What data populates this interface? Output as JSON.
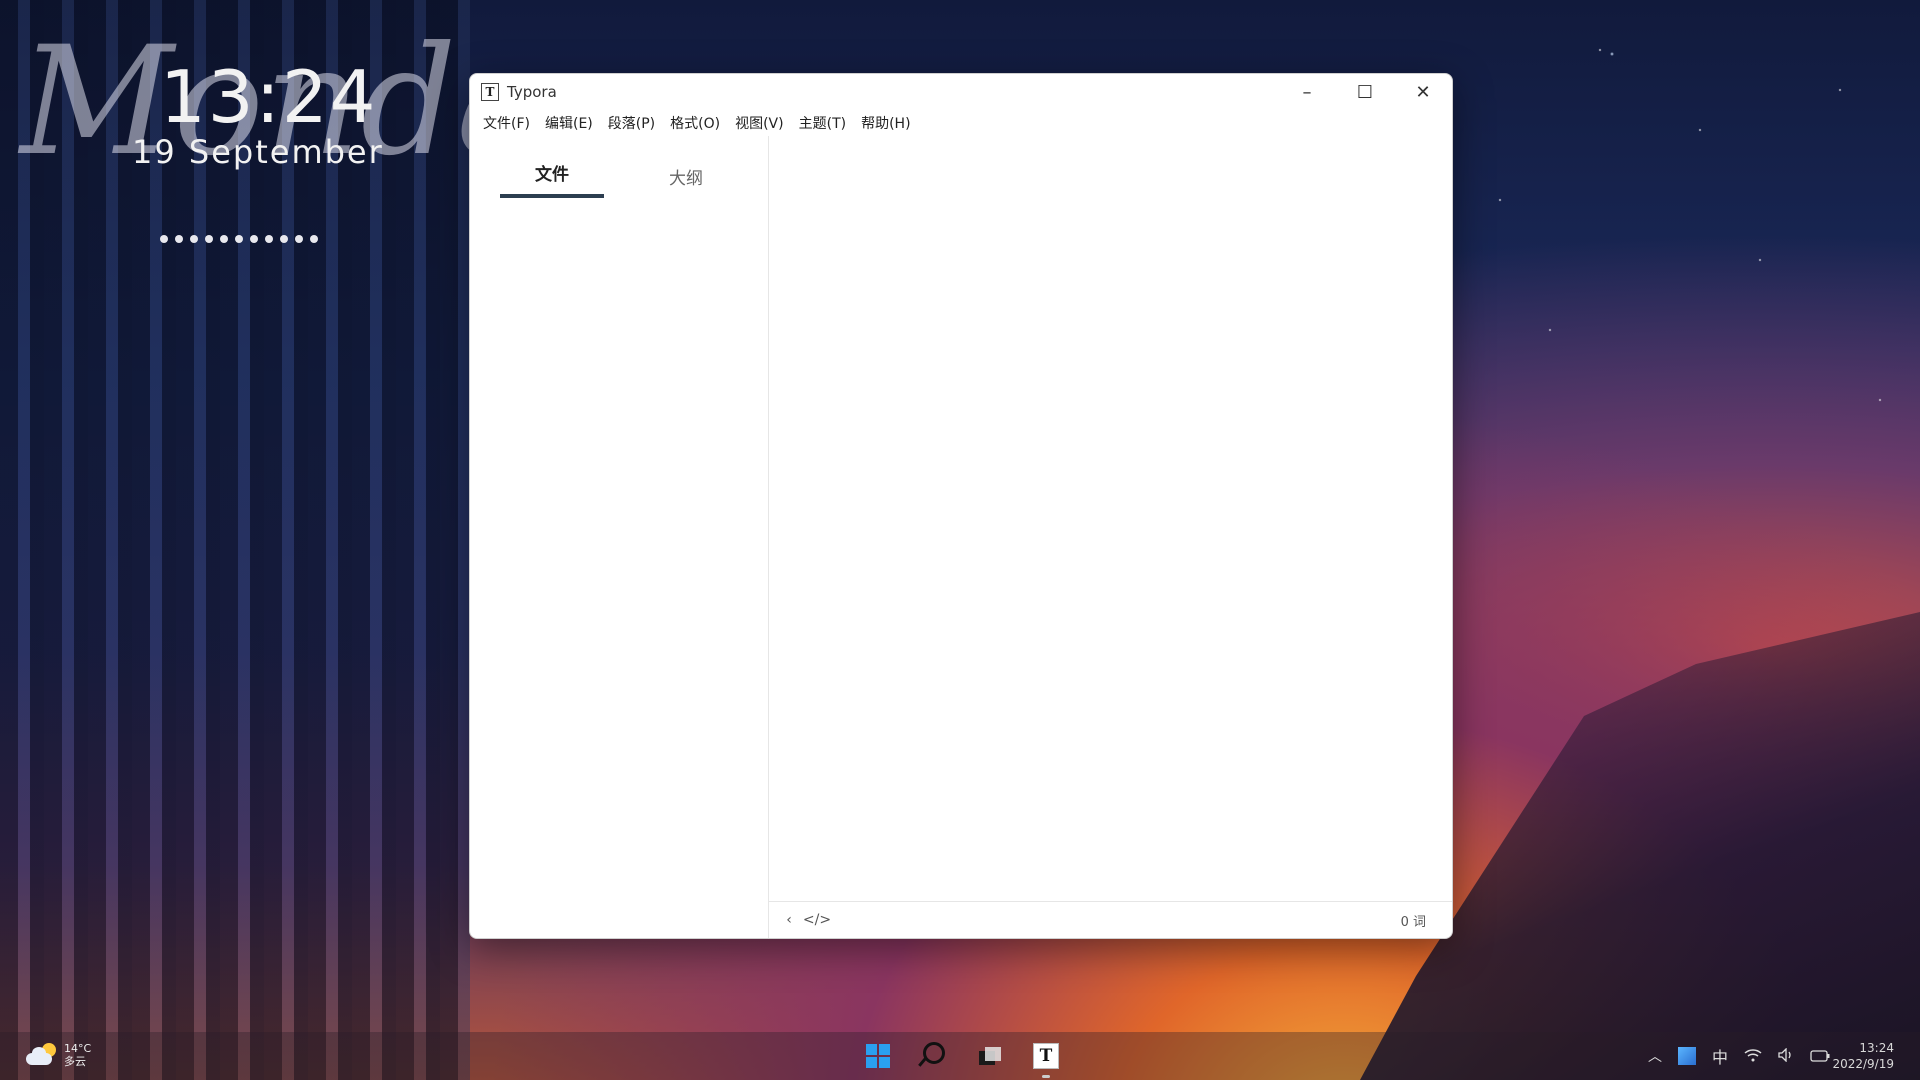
{
  "desktop": {
    "watermark": "Monday",
    "time": "13:24",
    "date": "19 September",
    "dot_count": 11
  },
  "window": {
    "title": "Typora",
    "app_icon": "T",
    "caption": {
      "minimize": "–",
      "maximize": "☐",
      "close": "✕"
    },
    "menu": [
      "文件(F)",
      "编辑(E)",
      "段落(P)",
      "格式(O)",
      "视图(V)",
      "主题(T)",
      "帮助(H)"
    ],
    "sidebar_tabs": [
      {
        "label": "文件",
        "active": true
      },
      {
        "label": "大纲",
        "active": false
      }
    ],
    "status": {
      "back_icon": "‹",
      "source_icon": "</>",
      "word_count": "0 词"
    }
  },
  "taskbar": {
    "weather": {
      "temp": "14°C",
      "desc": "多云"
    },
    "tray_ime": "中",
    "clock_time": "13:24",
    "clock_date": "2022/9/19",
    "typora_icon": "T"
  },
  "colors": {
    "tab_underline": "#2c3e50",
    "window_bg": "#ffffff",
    "win_logo": "#2aa0f0"
  }
}
